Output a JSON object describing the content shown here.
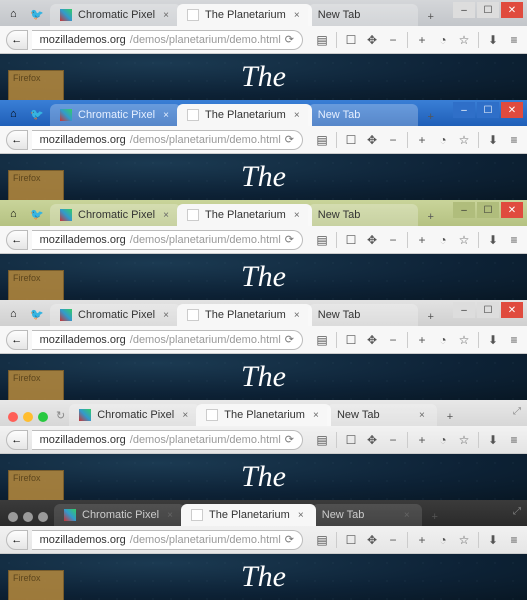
{
  "url": {
    "host": "mozillademos.org",
    "path": "/demos/planetarium/demo.html"
  },
  "tabs": {
    "chromatic": "Chromatic Pixel",
    "planetarium": "The Planetarium",
    "newtab": "New Tab"
  },
  "content": {
    "heading": "The",
    "badge_label": "Firefox"
  },
  "glyphs": {
    "close_x": "×",
    "plus": "+",
    "back_arrow": "←",
    "reload": "⟳",
    "rss": "▤",
    "reader": "☐",
    "move": "✥",
    "minus": "−",
    "plus2": "+",
    "clock": "◔",
    "star": "☆",
    "down": "⬇",
    "menu": "≡",
    "win_min": "–",
    "win_max": "☐",
    "win_close": "✕",
    "mac_expand": "⤢",
    "home": "⌂",
    "twitter": "🐦",
    "sync": "↻"
  }
}
